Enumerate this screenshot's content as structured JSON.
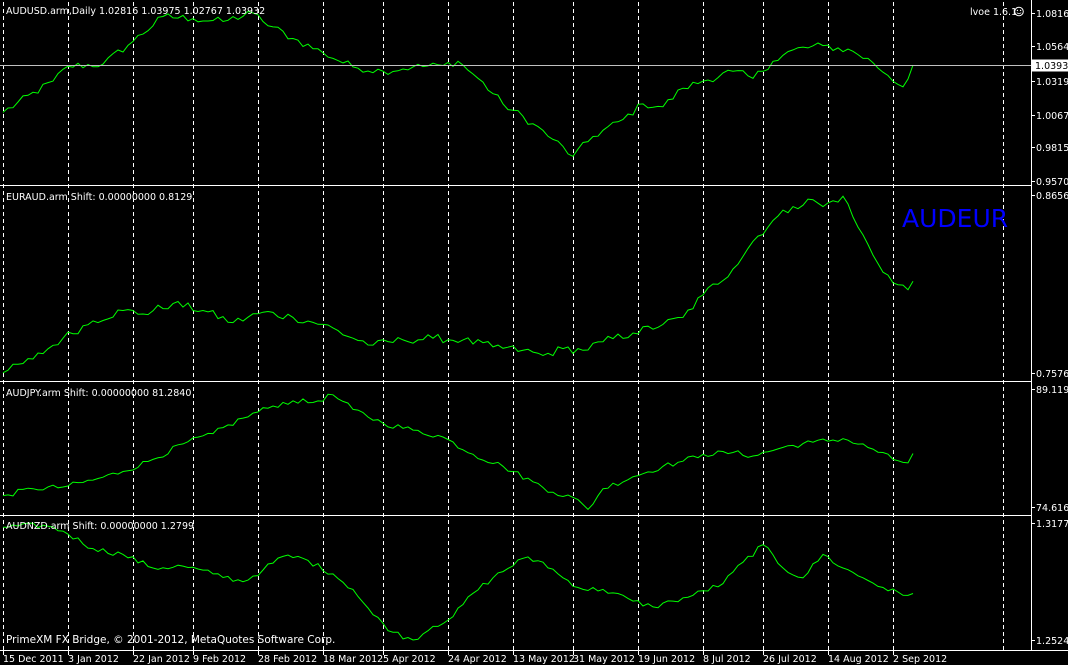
{
  "footer": "PrimeXM FX Bridge, © 2001-2012, MetaQuotes Software Corp.",
  "indicator_label": "lvoe 1.6.1",
  "overlay_label": "AUDEUR",
  "colors": {
    "background": "#000000",
    "line": "#00ff00",
    "grid": "#ffffff",
    "text": "#ffffff",
    "overlay": "#0000ff"
  },
  "x_axis": {
    "ticks": [
      {
        "label": "15 Dec 2011",
        "index": 0
      },
      {
        "label": "3 Jan 2012",
        "index": 13
      },
      {
        "label": "22 Jan 2012",
        "index": 26
      },
      {
        "label": "9 Feb 2012",
        "index": 38
      },
      {
        "label": "28 Feb 2012",
        "index": 51
      },
      {
        "label": "18 Mar 2012",
        "index": 64
      },
      {
        "label": "5 Apr 2012",
        "index": 76
      },
      {
        "label": "24 Apr 2012",
        "index": 89
      },
      {
        "label": "13 May 2012",
        "index": 102
      },
      {
        "label": "31 May 2012",
        "index": 114
      },
      {
        "label": "19 Jun 2012",
        "index": 127
      },
      {
        "label": "8 Jul 2012",
        "index": 140
      },
      {
        "label": "26 Jul 2012",
        "index": 152
      },
      {
        "label": "14 Aug 2012",
        "index": 165
      },
      {
        "label": "2 Sep 2012",
        "index": 178
      }
    ],
    "grid_index": [
      0,
      13,
      26,
      38,
      51,
      64,
      76,
      89,
      102,
      114,
      127,
      140,
      152,
      165,
      178,
      200
    ]
  },
  "chart_data": [
    {
      "type": "line",
      "header": "AUDUSD.arm,Daily  1.02816 1.03975 1.02767 1.03932",
      "ylim": [
        0.957,
        1.0816
      ],
      "y_ticks": [
        "1.08160",
        "1.05640",
        "1.03190",
        "1.00670",
        "0.98150",
        "0.95700"
      ],
      "y_tick_values": [
        1.0816,
        1.0564,
        1.0319,
        1.0067,
        0.9815,
        0.957
      ],
      "current_price": "1.03932",
      "current_value": 1.03932,
      "key_points": [
        [
          0,
          1.006
        ],
        [
          10,
          1.028
        ],
        [
          13,
          1.0385
        ],
        [
          20,
          1.04
        ],
        [
          26,
          1.056
        ],
        [
          32,
          1.0735
        ],
        [
          38,
          1.072
        ],
        [
          44,
          1.07
        ],
        [
          50,
          1.076
        ],
        [
          52,
          1.07
        ],
        [
          58,
          1.058
        ],
        [
          64,
          1.048
        ],
        [
          70,
          1.038
        ],
        [
          76,
          1.035
        ],
        [
          82,
          1.038
        ],
        [
          88,
          1.039
        ],
        [
          91,
          1.042
        ],
        [
          95,
          1.03
        ],
        [
          100,
          1.012
        ],
        [
          106,
          0.998
        ],
        [
          110,
          0.987
        ],
        [
          114,
          0.975
        ],
        [
          118,
          0.989
        ],
        [
          124,
          1.001
        ],
        [
          128,
          1.012
        ],
        [
          132,
          1.01
        ],
        [
          136,
          1.023
        ],
        [
          140,
          1.028
        ],
        [
          146,
          1.035
        ],
        [
          150,
          1.03
        ],
        [
          154,
          1.042
        ],
        [
          158,
          1.05
        ],
        [
          164,
          1.053
        ],
        [
          170,
          1.049
        ],
        [
          174,
          1.041
        ],
        [
          177,
          1.032
        ],
        [
          180,
          1.024
        ],
        [
          182,
          1.0393
        ]
      ]
    },
    {
      "type": "line",
      "header": "EURAUD.arm Shift: 0.00000000 0.8129",
      "ylim": [
        0.7576,
        0.8656
      ],
      "y_ticks": [
        "0.8656",
        "0.7576"
      ],
      "y_tick_values": [
        0.8656,
        0.7576
      ],
      "key_points": [
        [
          0,
          0.76
        ],
        [
          6,
          0.768
        ],
        [
          12,
          0.78
        ],
        [
          18,
          0.79
        ],
        [
          24,
          0.796
        ],
        [
          28,
          0.794
        ],
        [
          34,
          0.8
        ],
        [
          40,
          0.796
        ],
        [
          46,
          0.789
        ],
        [
          52,
          0.795
        ],
        [
          58,
          0.792
        ],
        [
          64,
          0.788
        ],
        [
          70,
          0.78
        ],
        [
          74,
          0.776
        ],
        [
          80,
          0.779
        ],
        [
          86,
          0.78
        ],
        [
          92,
          0.779
        ],
        [
          98,
          0.775
        ],
        [
          104,
          0.773
        ],
        [
          108,
          0.77
        ],
        [
          112,
          0.774
        ],
        [
          116,
          0.773
        ],
        [
          120,
          0.778
        ],
        [
          126,
          0.783
        ],
        [
          132,
          0.788
        ],
        [
          136,
          0.792
        ],
        [
          140,
          0.805
        ],
        [
          146,
          0.82
        ],
        [
          150,
          0.836
        ],
        [
          154,
          0.848
        ],
        [
          158,
          0.856
        ],
        [
          162,
          0.86
        ],
        [
          164,
          0.856
        ],
        [
          168,
          0.862
        ],
        [
          170,
          0.85
        ],
        [
          174,
          0.828
        ],
        [
          178,
          0.812
        ],
        [
          181,
          0.808
        ],
        [
          182,
          0.8129
        ]
      ]
    },
    {
      "type": "line",
      "header": "AUDJPY.arm Shift: 0.00000000 81.2840",
      "ylim": [
        74.6168,
        89.1192
      ],
      "y_ticks": [
        "89.1192",
        "74.6168"
      ],
      "y_tick_values": [
        89.1192,
        74.6168
      ],
      "key_points": [
        [
          0,
          76.4
        ],
        [
          6,
          77.2
        ],
        [
          12,
          77.4
        ],
        [
          18,
          78.2
        ],
        [
          24,
          79.2
        ],
        [
          30,
          80.6
        ],
        [
          36,
          82.4
        ],
        [
          42,
          83.6
        ],
        [
          48,
          85.4
        ],
        [
          54,
          86.8
        ],
        [
          58,
          87.4
        ],
        [
          62,
          87.2
        ],
        [
          66,
          88.1
        ],
        [
          70,
          86.4
        ],
        [
          76,
          84.8
        ],
        [
          82,
          84.0
        ],
        [
          88,
          83.2
        ],
        [
          94,
          81.2
        ],
        [
          100,
          79.8
        ],
        [
          106,
          78.0
        ],
        [
          110,
          76.8
        ],
        [
          114,
          76.2
        ],
        [
          117,
          74.8
        ],
        [
          120,
          77.2
        ],
        [
          126,
          78.6
        ],
        [
          132,
          79.8
        ],
        [
          136,
          80.4
        ],
        [
          140,
          81.2
        ],
        [
          146,
          81.4
        ],
        [
          150,
          81.0
        ],
        [
          156,
          82.0
        ],
        [
          162,
          82.6
        ],
        [
          168,
          83.0
        ],
        [
          174,
          81.8
        ],
        [
          178,
          80.6
        ],
        [
          181,
          80.2
        ],
        [
          182,
          81.284
        ]
      ]
    },
    {
      "type": "line",
      "header": "AUDNZD.arm Shift: 0.00000000 1.2799",
      "ylim": [
        1.2524,
        1.3177
      ],
      "y_ticks": [
        "1.3177",
        "1.2524"
      ],
      "y_tick_values": [
        1.3177,
        1.2524
      ],
      "key_points": [
        [
          0,
          1.314
        ],
        [
          8,
          1.315
        ],
        [
          12,
          1.312
        ],
        [
          18,
          1.303
        ],
        [
          24,
          1.3
        ],
        [
          30,
          1.293
        ],
        [
          36,
          1.294
        ],
        [
          42,
          1.29
        ],
        [
          48,
          1.286
        ],
        [
          52,
          1.292
        ],
        [
          56,
          1.299
        ],
        [
          60,
          1.298
        ],
        [
          66,
          1.29
        ],
        [
          70,
          1.282
        ],
        [
          74,
          1.269
        ],
        [
          78,
          1.26
        ],
        [
          82,
          1.256
        ],
        [
          86,
          1.263
        ],
        [
          90,
          1.268
        ],
        [
          94,
          1.28
        ],
        [
          98,
          1.288
        ],
        [
          104,
          1.298
        ],
        [
          108,
          1.296
        ],
        [
          112,
          1.288
        ],
        [
          116,
          1.282
        ],
        [
          120,
          1.282
        ],
        [
          126,
          1.276
        ],
        [
          130,
          1.273
        ],
        [
          134,
          1.276
        ],
        [
          138,
          1.279
        ],
        [
          144,
          1.285
        ],
        [
          148,
          1.296
        ],
        [
          152,
          1.305
        ],
        [
          156,
          1.293
        ],
        [
          160,
          1.288
        ],
        [
          164,
          1.3
        ],
        [
          168,
          1.293
        ],
        [
          172,
          1.288
        ],
        [
          176,
          1.283
        ],
        [
          180,
          1.279
        ],
        [
          182,
          1.2799
        ]
      ]
    }
  ]
}
